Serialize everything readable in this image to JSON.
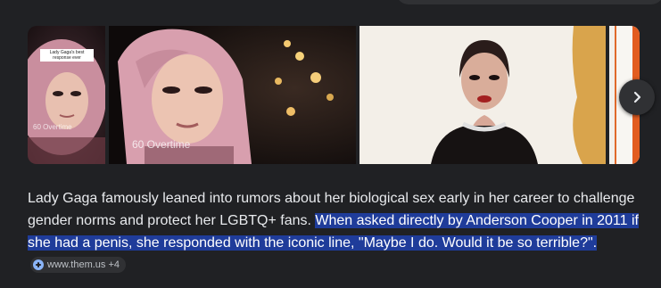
{
  "carousel": {
    "images": [
      {
        "caption": "Lady Gaga's best response ever",
        "watermark": "60 Overtime"
      },
      {
        "watermark": "60 Overtime"
      },
      {},
      {}
    ],
    "next_icon": "chevron-right-icon"
  },
  "answer": {
    "plain": "Lady Gaga famously leaned into rumors about her biological sex early in her career to challenge gender norms and protect her LGBTQ+ fans. ",
    "highlighted": "When asked directly by Anderson Cooper in 2011 if she had a penis, she responded with the iconic line, \"Maybe I do. Would it be so terrible?\".",
    "source": {
      "label": "www.them.us +4",
      "icon": "site-favicon-icon"
    }
  },
  "colors": {
    "background": "#202124",
    "text": "#e8eaed",
    "highlight": "#1f3c9a",
    "chip": "#303134"
  }
}
